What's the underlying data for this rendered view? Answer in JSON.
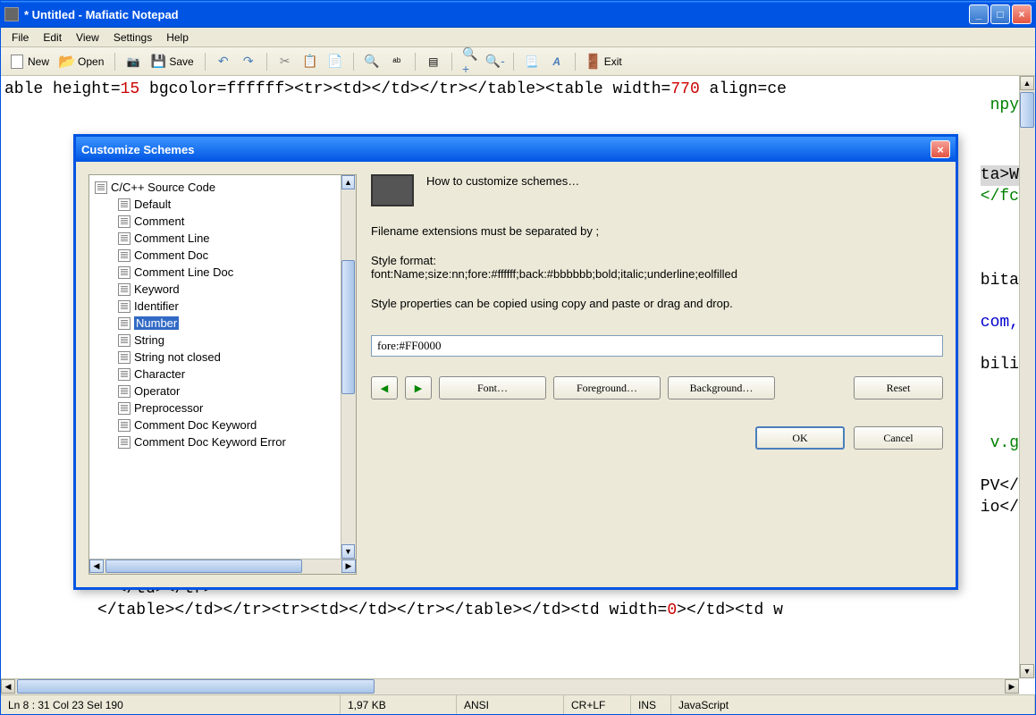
{
  "window": {
    "title": "* Untitled - Mafiatic Notepad"
  },
  "menubar": [
    "File",
    "Edit",
    "View",
    "Settings",
    "Help"
  ],
  "toolbar": {
    "new": "New",
    "open": "Open",
    "save": "Save",
    "exit": "Exit"
  },
  "editor": {
    "line1_a": "able height=",
    "line1_n1": "15",
    "line1_b": " bgcolor=ffffff><tr><td></td></tr></table><table width=",
    "line1_n2": "770",
    "line1_c": " align=ce",
    "frag_npy": "npy",
    "frag_ta": "ta>W",
    "frag_fc": "</fc",
    "frag_bita": "bita",
    "frag_com": "com,",
    "frag_bili": "bili",
    "frag_vg": "v.g",
    "frag_pv": "PV</",
    "frag_io": "io</",
    "line_tbl1": "              </table>",
    "line_tdtr": "            </td></tr>",
    "line_tbl2_a": "          </table></td></tr><tr><td></td></tr></table></td><td width=",
    "line_tbl2_n": "0",
    "line_tbl2_b": "></td><td w"
  },
  "dialog": {
    "title": "Customize Schemes",
    "tree_root": "C/C++ Source Code",
    "tree_items": [
      "Default",
      "Comment",
      "Comment Line",
      "Comment Doc",
      "Comment Line Doc",
      "Keyword",
      "Identifier",
      "Number",
      "String",
      "String not closed",
      "Character",
      "Operator",
      "Preprocessor",
      "Comment Doc Keyword",
      "Comment Doc Keyword Error"
    ],
    "tree_selected_index": 7,
    "help_title": "How to customize schemes…",
    "help_ext": "Filename extensions must be separated by ;",
    "help_fmt_label": "Style format:",
    "help_fmt": "font:Name;size:nn;fore:#ffffff;back:#bbbbbb;bold;italic;underline;eolfilled",
    "help_copy": "Style properties can be copied using copy and paste or drag and drop.",
    "style_value": "fore:#FF0000",
    "btn_font": "Font…",
    "btn_fore": "Foreground…",
    "btn_back": "Background…",
    "btn_reset": "Reset",
    "btn_ok": "OK",
    "btn_cancel": "Cancel"
  },
  "statusbar": {
    "pos": "Ln 8 : 31   Col 23   Sel 190",
    "size": "1,97 KB",
    "enc": "ANSI",
    "eol": "CR+LF",
    "ins": "INS",
    "lang": "JavaScript"
  }
}
